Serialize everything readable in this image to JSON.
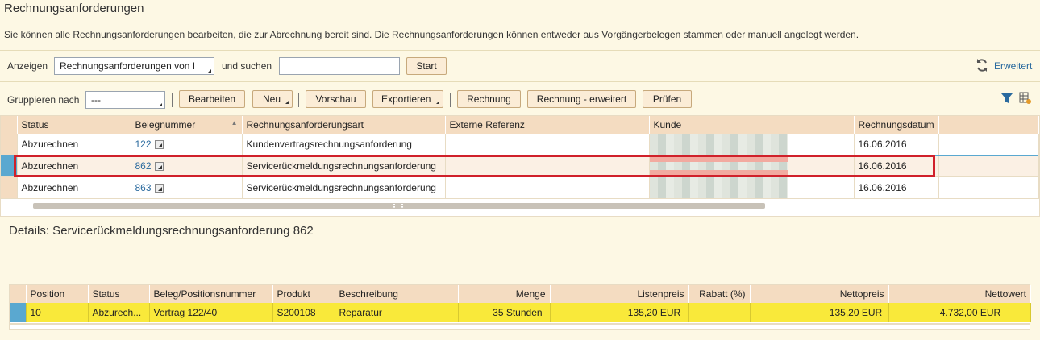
{
  "page": {
    "title": "Rechnungsanforderungen",
    "description": "Sie können alle Rechnungsanforderungen bearbeiten, die zur Abrechnung bereit sind. Die Rechnungsanforderungen können entweder aus Vorgängerbelegen stammen oder manuell angelegt werden."
  },
  "search": {
    "show_label": "Anzeigen",
    "show_value": "Rechnungsanforderungen von I",
    "and_search_label": "und suchen",
    "search_value": "",
    "start_label": "Start",
    "advanced_label": "Erweitert"
  },
  "toolbar": {
    "group_label": "Gruppieren nach",
    "group_value": "---",
    "edit": "Bearbeiten",
    "new": "Neu",
    "preview": "Vorschau",
    "export": "Exportieren",
    "invoice": "Rechnung",
    "invoice_ext": "Rechnung - erweitert",
    "check": "Prüfen"
  },
  "table": {
    "columns": [
      "Status",
      "Belegnummer",
      "Rechnungsanforderungsart",
      "Externe Referenz",
      "Kunde",
      "Rechnungsdatum"
    ],
    "rows": [
      {
        "status": "Abzurechnen",
        "number": "122",
        "type": "Kundenvertragsrechnungsanforderung",
        "ref": "",
        "date": "16.06.2016"
      },
      {
        "status": "Abzurechnen",
        "number": "862",
        "type": "Servicerückmeldungsrechnungsanforderung",
        "ref": "",
        "date": "16.06.2016"
      },
      {
        "status": "Abzurechnen",
        "number": "863",
        "type": "Servicerückmeldungsrechnungsanforderung",
        "ref": "",
        "date": "16.06.2016"
      }
    ]
  },
  "details": {
    "title": "Details: Servicerückmeldungsrechnungsanforderung 862",
    "columns": [
      "Position",
      "Status",
      "Beleg/Positionsnummer",
      "Produkt",
      "Beschreibung",
      "Menge",
      "Listenpreis",
      "Rabatt (%)",
      "Nettopreis",
      "Nettowert"
    ],
    "row": {
      "position": "10",
      "status": "Abzurech...",
      "beleg": "Vertrag  122/40",
      "product": "S200108",
      "description": "Reparatur",
      "qty": "35",
      "unit": "Stunden",
      "list_price": "135,20",
      "list_cur": "EUR",
      "discount": "",
      "net_price": "135,20",
      "net_price_cur": "EUR",
      "net_value": "4.732,00",
      "net_value_cur": "EUR"
    }
  },
  "colors": {
    "highlight_border": "#d0202a",
    "selected_marker": "#5aa8d0",
    "detail_row": "#f9e93a"
  }
}
